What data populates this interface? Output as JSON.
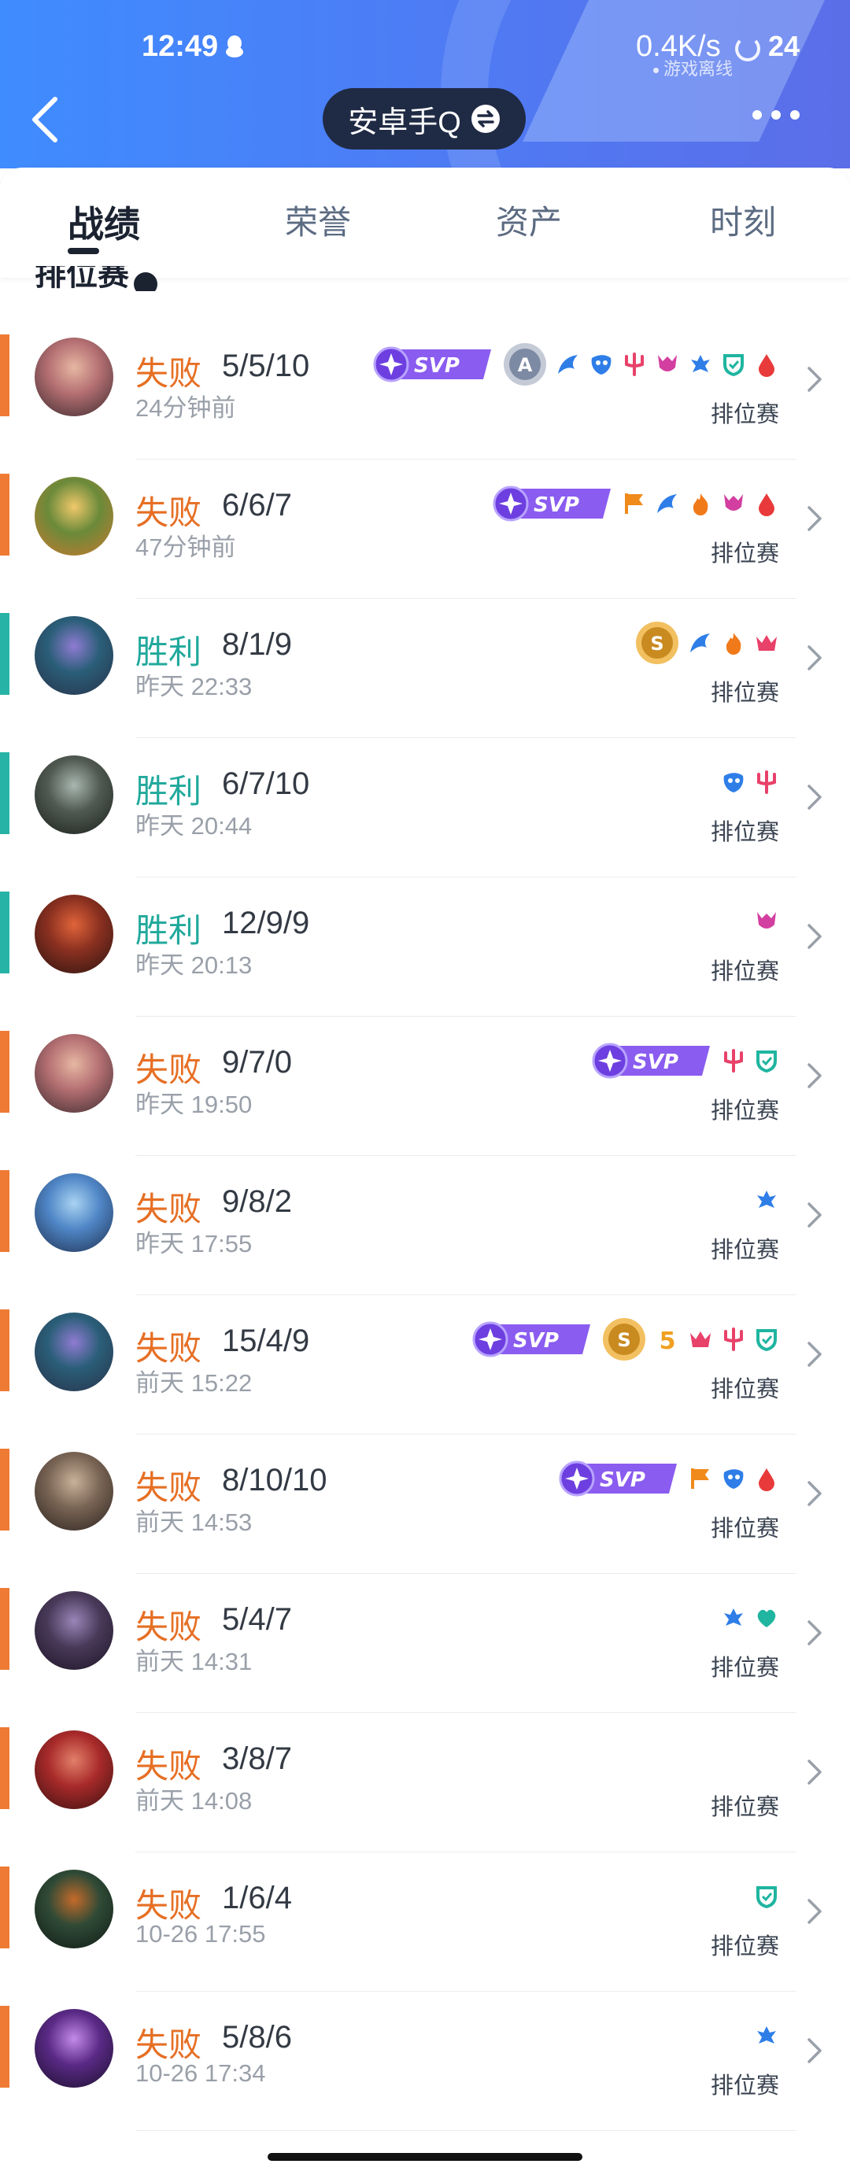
{
  "status_bar": {
    "time": "12:49",
    "net_speed": "0.4K/s",
    "battery": "24",
    "offline_text": "游戏离线"
  },
  "header": {
    "account_name": "安卓手Q"
  },
  "tabs": [
    {
      "label": "战绩",
      "active": true
    },
    {
      "label": "荣誉",
      "active": false
    },
    {
      "label": "资产",
      "active": false
    },
    {
      "label": "时刻",
      "active": false
    }
  ],
  "filter": {
    "label": "排位赛"
  },
  "colors": {
    "loss": "#e66f24",
    "win": "#21a99c",
    "header_blue": "#4d7cf5",
    "svp_purple": "#8a5cf0"
  },
  "matches": [
    {
      "result": "失败",
      "kda": "5/5/10",
      "time": "24分钟前",
      "mode": "排位赛",
      "outcome": "loss",
      "avatar": "champion-pink-hair",
      "badges": [
        "svp",
        "medal-a",
        "blue-wing",
        "blue-mask",
        "pink-trident",
        "pink-demon",
        "blue-tree",
        "teal-shield",
        "red-drop"
      ]
    },
    {
      "result": "失败",
      "kda": "6/6/7",
      "time": "47分钟前",
      "mode": "排位赛",
      "outcome": "loss",
      "avatar": "champion-yordle-hat",
      "badges": [
        "svp",
        "orange-flag",
        "blue-wing",
        "orange-flame",
        "pink-demon",
        "red-drop"
      ]
    },
    {
      "result": "胜利",
      "kda": "8/1/9",
      "time": "昨天 22:33",
      "mode": "排位赛",
      "outcome": "win",
      "avatar": "champion-teal-hair",
      "badges": [
        "medal-s",
        "blue-wing",
        "orange-flame",
        "pink-crown"
      ]
    },
    {
      "result": "胜利",
      "kda": "6/7/10",
      "time": "昨天 20:44",
      "mode": "排位赛",
      "outcome": "win",
      "avatar": "champion-armor-helmet",
      "badges": [
        "blue-mask",
        "pink-trident"
      ]
    },
    {
      "result": "胜利",
      "kda": "12/9/9",
      "time": "昨天 20:13",
      "mode": "排位赛",
      "outcome": "win",
      "avatar": "champion-red-mask",
      "badges": [
        "pink-demon"
      ]
    },
    {
      "result": "失败",
      "kda": "9/7/0",
      "time": "昨天 19:50",
      "mode": "排位赛",
      "outcome": "loss",
      "avatar": "champion-pink-hair",
      "badges": [
        "svp",
        "pink-trident",
        "teal-shield"
      ]
    },
    {
      "result": "失败",
      "kda": "9/8/2",
      "time": "昨天 17:55",
      "mode": "排位赛",
      "outcome": "loss",
      "avatar": "champion-blue-fish",
      "badges": [
        "blue-tree"
      ]
    },
    {
      "result": "失败",
      "kda": "15/4/9",
      "time": "前天 15:22",
      "mode": "排位赛",
      "outcome": "loss",
      "avatar": "champion-teal-hair",
      "badges": [
        "svp",
        "medal-s",
        "five-kill",
        "pink-crown",
        "pink-trident",
        "teal-shield"
      ]
    },
    {
      "result": "失败",
      "kda": "8/10/10",
      "time": "前天 14:53",
      "mode": "排位赛",
      "outcome": "loss",
      "avatar": "champion-warrior-blade",
      "badges": [
        "svp",
        "orange-flag",
        "blue-mask",
        "red-drop"
      ]
    },
    {
      "result": "失败",
      "kda": "5/4/7",
      "time": "前天 14:31",
      "mode": "排位赛",
      "outcome": "loss",
      "avatar": "champion-purple-hood",
      "badges": [
        "blue-tree",
        "teal-heart"
      ]
    },
    {
      "result": "失败",
      "kda": "3/8/7",
      "time": "前天 14:08",
      "mode": "排位赛",
      "outcome": "loss",
      "avatar": "champion-red-hair",
      "badges": []
    },
    {
      "result": "失败",
      "kda": "1/6/4",
      "time": "10-26 17:55",
      "mode": "排位赛",
      "outcome": "loss",
      "avatar": "champion-dark-green",
      "badges": [
        "teal-shield"
      ]
    },
    {
      "result": "失败",
      "kda": "5/8/6",
      "time": "10-26 17:34",
      "mode": "排位赛",
      "outcome": "loss",
      "avatar": "champion-violet-mage",
      "badges": [
        "blue-tree"
      ]
    }
  ]
}
